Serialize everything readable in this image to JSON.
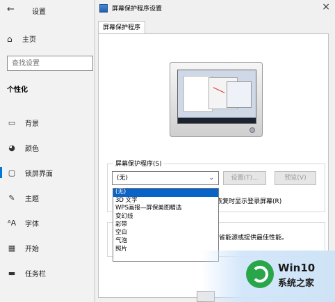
{
  "settings": {
    "title": "设置",
    "home": "主页",
    "search_placeholder": "查找设置",
    "section": "个性化",
    "nav": [
      {
        "label": "背景",
        "icon": "image-icon"
      },
      {
        "label": "颜色",
        "icon": "palette-icon"
      },
      {
        "label": "锁屏界面",
        "icon": "monitor-icon",
        "active": true
      },
      {
        "label": "主题",
        "icon": "brush-icon"
      },
      {
        "label": "字体",
        "icon": "font-icon"
      },
      {
        "label": "开始",
        "icon": "grid-icon"
      },
      {
        "label": "任务栏",
        "icon": "taskbar-icon"
      }
    ]
  },
  "dialog": {
    "title": "屏幕保护程序设置",
    "tab": "屏幕保护程序",
    "group_label": "屏幕保护程序(S)",
    "selected": "(无)",
    "settings_button": "设置(T)...",
    "preview_button": "预览(V)",
    "resume_text": "恢复时显示登录屏幕(R)",
    "power_text": "省能源或提供最佳性能。",
    "options": [
      "(无)",
      "3D 文字",
      "WPS画报—屏保美图精选",
      "变幻线",
      "彩带",
      "空白",
      "气泡",
      "照片"
    ]
  },
  "watermark": {
    "line1": "Win10",
    "line2": "系统之家"
  }
}
